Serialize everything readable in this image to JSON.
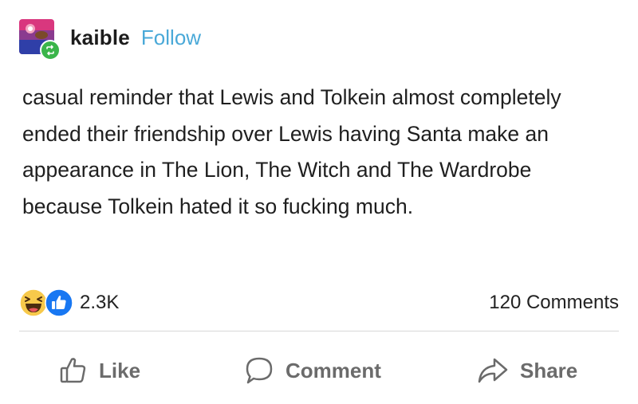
{
  "post": {
    "username": "kaible",
    "follow_label": "Follow",
    "body": "casual reminder that Lewis and Tolkein almost completely ended their friendship over Lewis having Santa make an appearance in The Lion, The Witch and The Wardrobe because Tolkein hated it so fucking much."
  },
  "reactions": {
    "icons": [
      "haha-icon",
      "like-reaction-icon"
    ],
    "count": "2.3K",
    "comments_count": "120 Comments"
  },
  "actions": {
    "like_label": "Like",
    "comment_label": "Comment",
    "share_label": "Share"
  },
  "colors": {
    "follow": "#4aa9d8",
    "reblog_badge": "#3ab54a",
    "like_blue": "#1877f2",
    "haha_yellow": "#f7c94b",
    "action_gray": "#6b6b6b"
  }
}
